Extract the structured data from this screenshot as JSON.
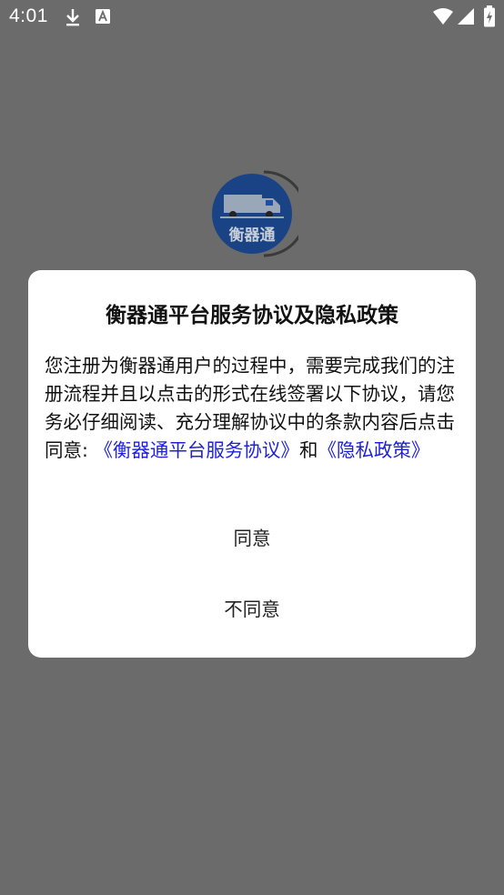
{
  "status_bar": {
    "time": "4:01",
    "icons": [
      "download-icon",
      "font-icon",
      "wifi-icon",
      "signal-icon",
      "battery-icon"
    ]
  },
  "splash": {
    "logo_text": "衡器通",
    "logo_color": "#1f4f9e"
  },
  "dialog": {
    "title": "衡器通平台服务协议及隐私政策",
    "body_text": "您注册为衡器通用户的过程中，需要完成我们的注册流程并且以点击的形式在线签署以下协议，请您务必仔细阅读、充分理解协议中的条款内容后点击同意: ",
    "link_service": "《衡器通平台服务协议》",
    "connector": "和",
    "link_privacy": "《隐私政策》",
    "agree_label": "同意",
    "disagree_label": "不同意"
  },
  "colors": {
    "overlay": "#6b6b6b",
    "link": "#1f22d6",
    "dialog_bg": "#ffffff"
  }
}
